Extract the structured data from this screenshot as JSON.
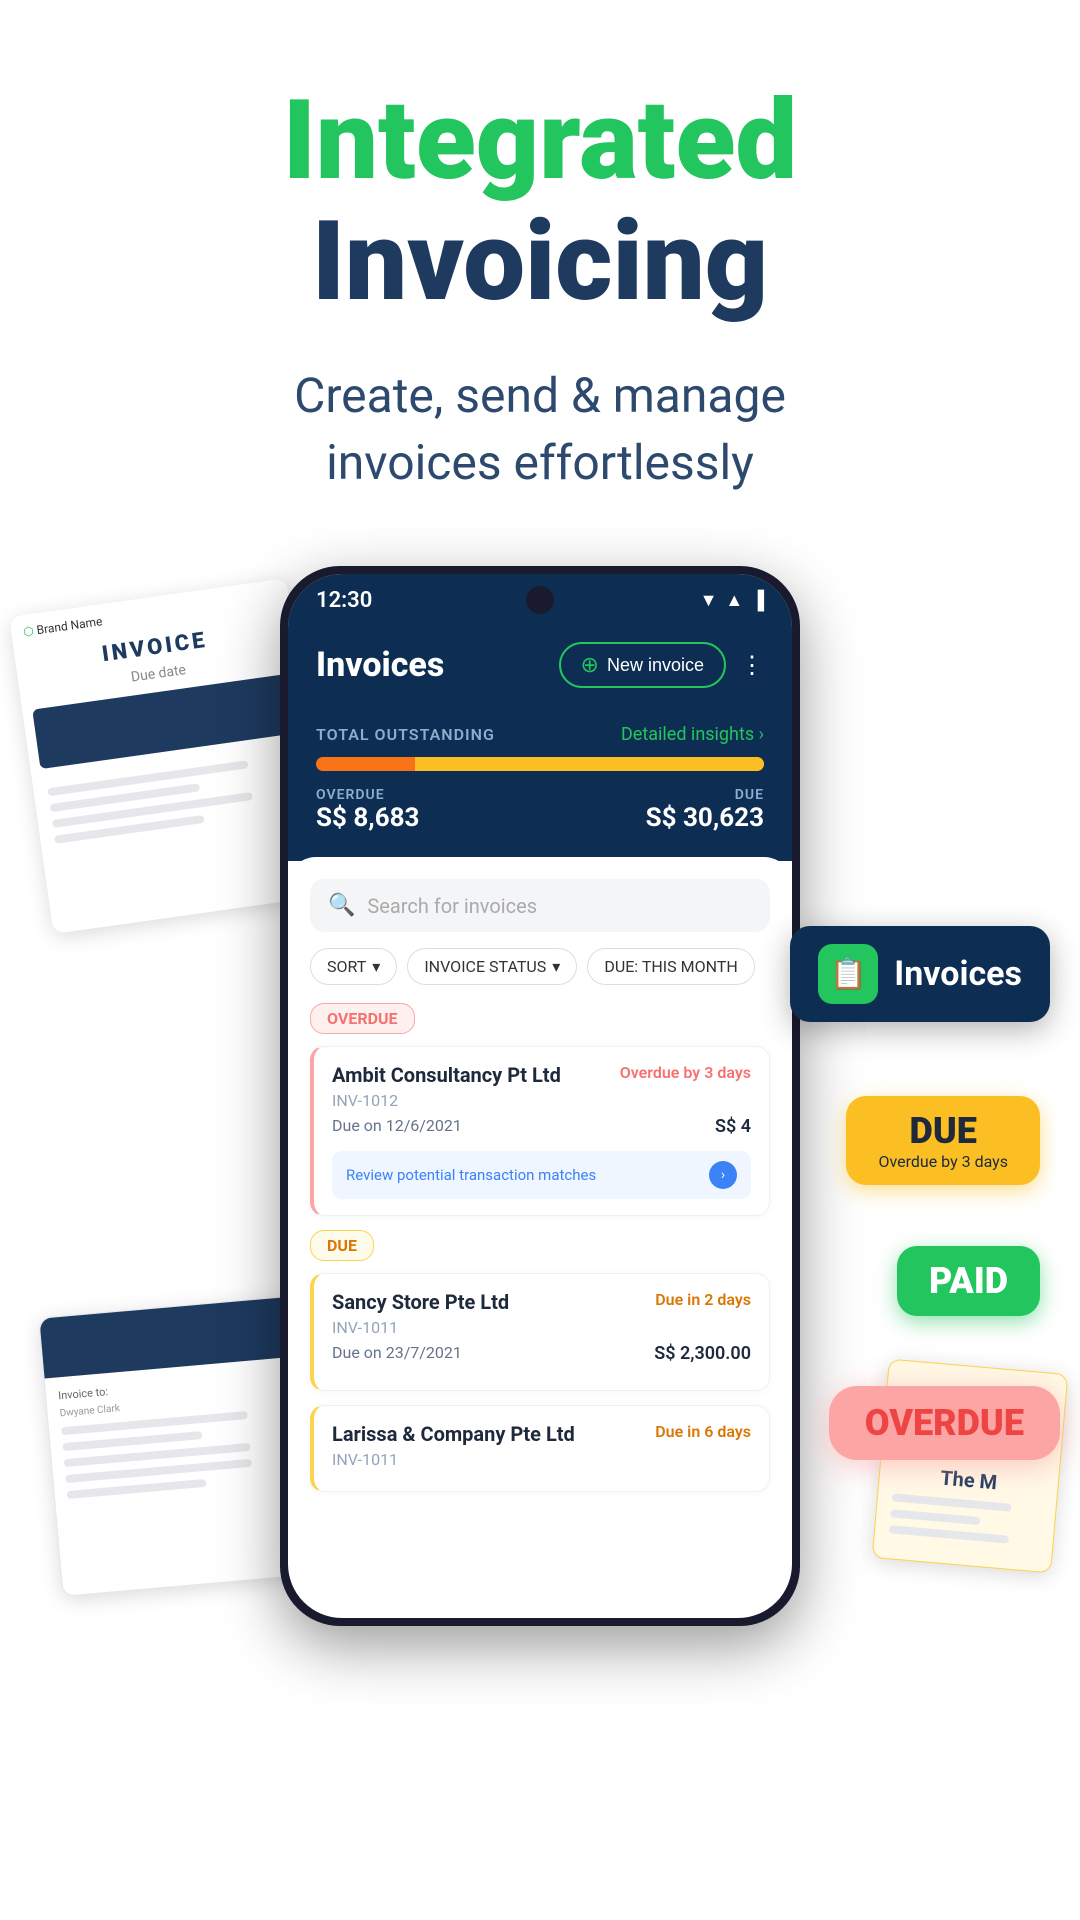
{
  "hero": {
    "title_green": "Integrated",
    "title_dark": "Invoicing",
    "subtitle_line1": "Create, send & manage",
    "subtitle_line2": "invoices effortlessly"
  },
  "phone": {
    "status_bar": {
      "time": "12:30",
      "icons": [
        "▼",
        "▲",
        "▐"
      ]
    },
    "header": {
      "title": "Invoices",
      "new_invoice_label": "New invoice",
      "more_icon": "⋮"
    },
    "outstanding": {
      "label": "TOTAL OUTSTANDING",
      "insights_label": "Detailed insights ›",
      "overdue_label": "OVERDUE",
      "overdue_amount": "S$ 8,683",
      "due_label": "DUE",
      "due_amount": "S$ 30,623"
    },
    "search": {
      "placeholder": "Search for invoices"
    },
    "filters": [
      {
        "label": "SORT",
        "has_arrow": true
      },
      {
        "label": "INVOICE STATUS",
        "has_arrow": true
      },
      {
        "label": "DUE: THIS MONTH",
        "has_arrow": false
      }
    ],
    "sections": [
      {
        "type": "OVERDUE",
        "invoices": [
          {
            "name": "Ambit Consultancy Pt Ltd",
            "number": "INV-1012",
            "due_date": "Due on 12/6/2021",
            "amount": "S$ 4",
            "status_text": "Overdue by 3 days",
            "status_type": "overdue",
            "has_transaction": true,
            "transaction_text": "Review potential transaction matches"
          }
        ]
      },
      {
        "type": "DUE",
        "invoices": [
          {
            "name": "Sancy Store Pte Ltd",
            "number": "INV-1011",
            "due_date": "Due on 23/7/2021",
            "amount": "S$ 2,300.00",
            "status_text": "Due in 2 days",
            "status_type": "due",
            "has_transaction": false
          },
          {
            "name": "Larissa & Company Pte Ltd",
            "number": "INV-1011",
            "due_date": "",
            "amount": "",
            "status_text": "Due in 6 days",
            "status_type": "due",
            "has_transaction": false
          }
        ]
      }
    ]
  },
  "floating_badges": {
    "invoices": "Invoices",
    "due": "DUE",
    "due_sub": "Overdue by 3 days",
    "paid": "PAID",
    "overdue": "OVERDUE"
  },
  "colors": {
    "green": "#22c55e",
    "dark_blue": "#1e3a5f",
    "navy": "#0d2d52",
    "overdue_red": "#ef4444",
    "due_yellow": "#d97706",
    "paid_green": "#22c55e"
  }
}
